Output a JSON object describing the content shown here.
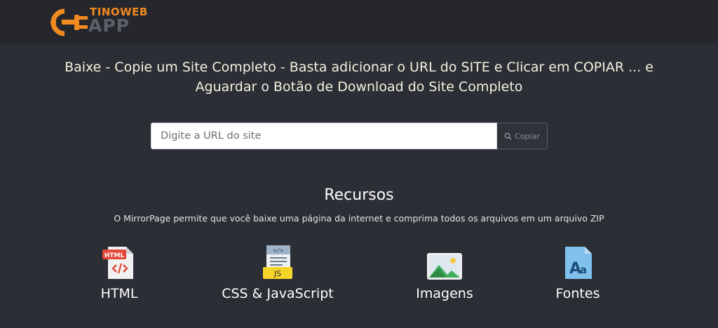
{
  "brand": {
    "name_top": "TINOWEB",
    "name_bottom": "APP",
    "accent": "#f28a22",
    "secondary": "#5c6069"
  },
  "headline": {
    "line1": "Baixe - Copie um Site Completo - Basta adicionar o URL do SITE e Clicar em COPIAR ... e",
    "line2": "Aguardar o Botão de Download do Site Completo"
  },
  "search": {
    "placeholder": "Digite a URL do site",
    "value": "",
    "button_label": "Copiar",
    "button_icon": "search-icon"
  },
  "features_section": {
    "title": "Recursos",
    "description": "O MirrorPage permite que você baixe uma página da internet e comprima todos os arquivos em um arquivo ZIP",
    "items": [
      {
        "label": "HTML",
        "icon": "html-file-icon"
      },
      {
        "label": "CSS & JavaScript",
        "icon": "js-file-icon"
      },
      {
        "label": "Imagens",
        "icon": "image-icon"
      },
      {
        "label": "Fontes",
        "icon": "font-icon"
      }
    ]
  },
  "colors": {
    "background": "#2b2e34",
    "header": "#25272c",
    "headline_text": "#f4f2e0"
  }
}
